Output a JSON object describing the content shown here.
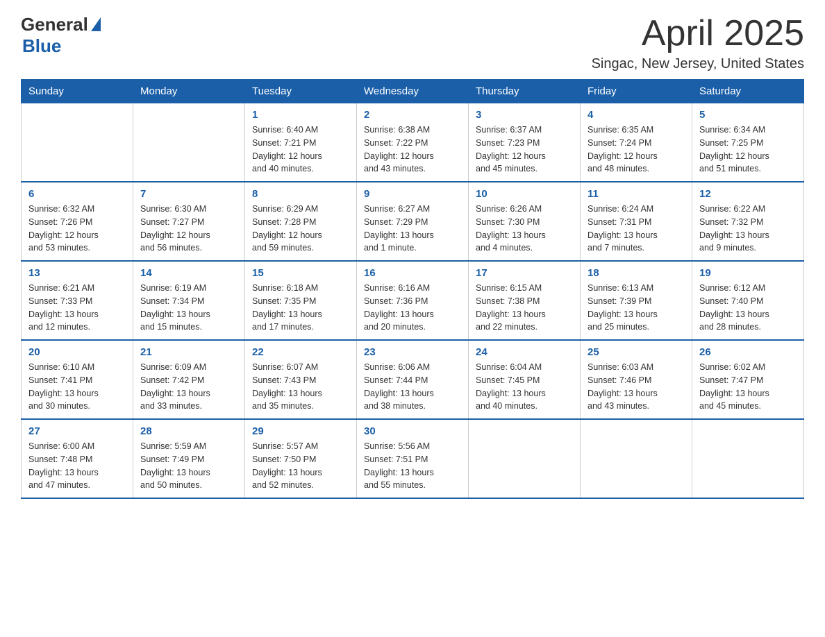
{
  "header": {
    "logo_general": "General",
    "logo_blue": "Blue",
    "month_title": "April 2025",
    "location": "Singac, New Jersey, United States"
  },
  "calendar": {
    "days_of_week": [
      "Sunday",
      "Monday",
      "Tuesday",
      "Wednesday",
      "Thursday",
      "Friday",
      "Saturday"
    ],
    "weeks": [
      [
        {
          "day": "",
          "info": ""
        },
        {
          "day": "",
          "info": ""
        },
        {
          "day": "1",
          "info": "Sunrise: 6:40 AM\nSunset: 7:21 PM\nDaylight: 12 hours\nand 40 minutes."
        },
        {
          "day": "2",
          "info": "Sunrise: 6:38 AM\nSunset: 7:22 PM\nDaylight: 12 hours\nand 43 minutes."
        },
        {
          "day": "3",
          "info": "Sunrise: 6:37 AM\nSunset: 7:23 PM\nDaylight: 12 hours\nand 45 minutes."
        },
        {
          "day": "4",
          "info": "Sunrise: 6:35 AM\nSunset: 7:24 PM\nDaylight: 12 hours\nand 48 minutes."
        },
        {
          "day": "5",
          "info": "Sunrise: 6:34 AM\nSunset: 7:25 PM\nDaylight: 12 hours\nand 51 minutes."
        }
      ],
      [
        {
          "day": "6",
          "info": "Sunrise: 6:32 AM\nSunset: 7:26 PM\nDaylight: 12 hours\nand 53 minutes."
        },
        {
          "day": "7",
          "info": "Sunrise: 6:30 AM\nSunset: 7:27 PM\nDaylight: 12 hours\nand 56 minutes."
        },
        {
          "day": "8",
          "info": "Sunrise: 6:29 AM\nSunset: 7:28 PM\nDaylight: 12 hours\nand 59 minutes."
        },
        {
          "day": "9",
          "info": "Sunrise: 6:27 AM\nSunset: 7:29 PM\nDaylight: 13 hours\nand 1 minute."
        },
        {
          "day": "10",
          "info": "Sunrise: 6:26 AM\nSunset: 7:30 PM\nDaylight: 13 hours\nand 4 minutes."
        },
        {
          "day": "11",
          "info": "Sunrise: 6:24 AM\nSunset: 7:31 PM\nDaylight: 13 hours\nand 7 minutes."
        },
        {
          "day": "12",
          "info": "Sunrise: 6:22 AM\nSunset: 7:32 PM\nDaylight: 13 hours\nand 9 minutes."
        }
      ],
      [
        {
          "day": "13",
          "info": "Sunrise: 6:21 AM\nSunset: 7:33 PM\nDaylight: 13 hours\nand 12 minutes."
        },
        {
          "day": "14",
          "info": "Sunrise: 6:19 AM\nSunset: 7:34 PM\nDaylight: 13 hours\nand 15 minutes."
        },
        {
          "day": "15",
          "info": "Sunrise: 6:18 AM\nSunset: 7:35 PM\nDaylight: 13 hours\nand 17 minutes."
        },
        {
          "day": "16",
          "info": "Sunrise: 6:16 AM\nSunset: 7:36 PM\nDaylight: 13 hours\nand 20 minutes."
        },
        {
          "day": "17",
          "info": "Sunrise: 6:15 AM\nSunset: 7:38 PM\nDaylight: 13 hours\nand 22 minutes."
        },
        {
          "day": "18",
          "info": "Sunrise: 6:13 AM\nSunset: 7:39 PM\nDaylight: 13 hours\nand 25 minutes."
        },
        {
          "day": "19",
          "info": "Sunrise: 6:12 AM\nSunset: 7:40 PM\nDaylight: 13 hours\nand 28 minutes."
        }
      ],
      [
        {
          "day": "20",
          "info": "Sunrise: 6:10 AM\nSunset: 7:41 PM\nDaylight: 13 hours\nand 30 minutes."
        },
        {
          "day": "21",
          "info": "Sunrise: 6:09 AM\nSunset: 7:42 PM\nDaylight: 13 hours\nand 33 minutes."
        },
        {
          "day": "22",
          "info": "Sunrise: 6:07 AM\nSunset: 7:43 PM\nDaylight: 13 hours\nand 35 minutes."
        },
        {
          "day": "23",
          "info": "Sunrise: 6:06 AM\nSunset: 7:44 PM\nDaylight: 13 hours\nand 38 minutes."
        },
        {
          "day": "24",
          "info": "Sunrise: 6:04 AM\nSunset: 7:45 PM\nDaylight: 13 hours\nand 40 minutes."
        },
        {
          "day": "25",
          "info": "Sunrise: 6:03 AM\nSunset: 7:46 PM\nDaylight: 13 hours\nand 43 minutes."
        },
        {
          "day": "26",
          "info": "Sunrise: 6:02 AM\nSunset: 7:47 PM\nDaylight: 13 hours\nand 45 minutes."
        }
      ],
      [
        {
          "day": "27",
          "info": "Sunrise: 6:00 AM\nSunset: 7:48 PM\nDaylight: 13 hours\nand 47 minutes."
        },
        {
          "day": "28",
          "info": "Sunrise: 5:59 AM\nSunset: 7:49 PM\nDaylight: 13 hours\nand 50 minutes."
        },
        {
          "day": "29",
          "info": "Sunrise: 5:57 AM\nSunset: 7:50 PM\nDaylight: 13 hours\nand 52 minutes."
        },
        {
          "day": "30",
          "info": "Sunrise: 5:56 AM\nSunset: 7:51 PM\nDaylight: 13 hours\nand 55 minutes."
        },
        {
          "day": "",
          "info": ""
        },
        {
          "day": "",
          "info": ""
        },
        {
          "day": "",
          "info": ""
        }
      ]
    ]
  }
}
